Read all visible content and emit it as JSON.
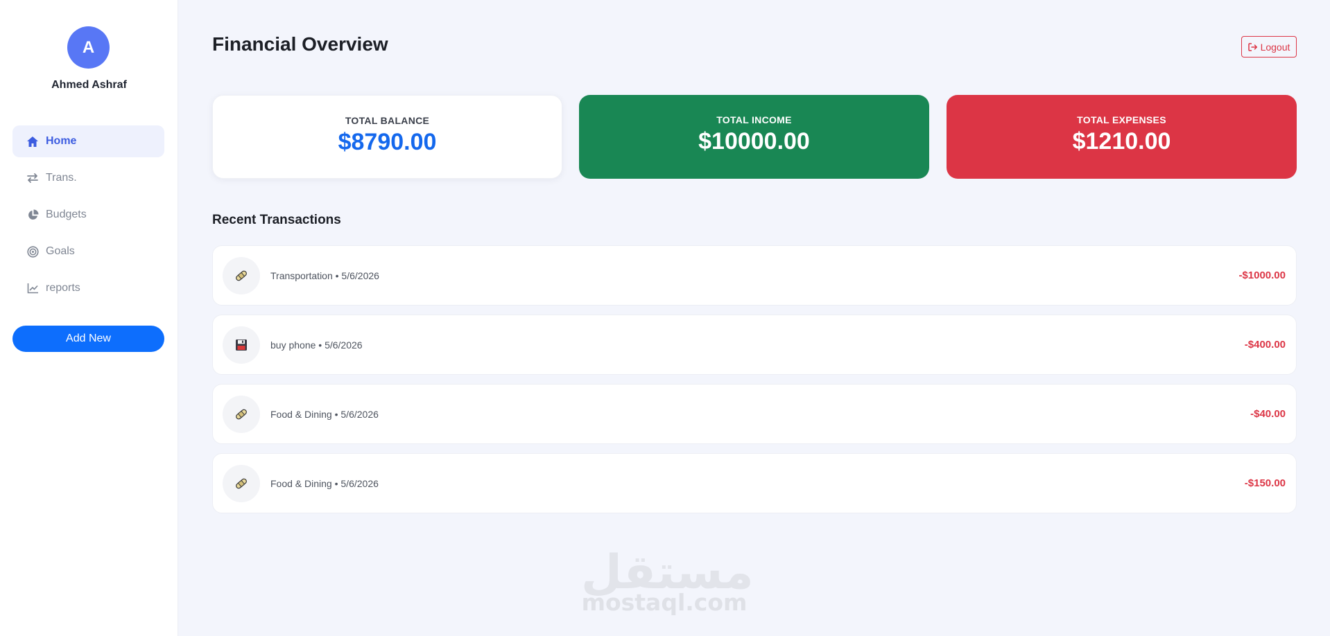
{
  "user": {
    "avatar_letter": "A",
    "name": "Ahmed Ashraf"
  },
  "sidebar": {
    "items": [
      {
        "label": "Home",
        "icon": "home-icon",
        "active": true
      },
      {
        "label": "Trans.",
        "icon": "transfer-arrows-icon",
        "active": false
      },
      {
        "label": "Budgets",
        "icon": "pie-chart-icon",
        "active": false
      },
      {
        "label": "Goals",
        "icon": "target-icon",
        "active": false
      },
      {
        "label": "reports",
        "icon": "line-chart-icon",
        "active": false
      }
    ],
    "add_button_label": "Add New"
  },
  "header": {
    "title": "Financial Overview",
    "logout_label": "Logout"
  },
  "summary": {
    "balance": {
      "label": "TOTAL BALANCE",
      "value": "$8790.00"
    },
    "income": {
      "label": "TOTAL INCOME",
      "value": "$10000.00"
    },
    "expenses": {
      "label": "TOTAL EXPENSES",
      "value": "$1210.00"
    }
  },
  "transactions": {
    "title": "Recent Transactions",
    "items": [
      {
        "icon": "bandage-emoji-icon",
        "description": "Transportation • 5/6/2026",
        "amount": "-$1000.00"
      },
      {
        "icon": "floppy-disk-emoji-icon",
        "description": "buy phone • 5/6/2026",
        "amount": "-$400.00"
      },
      {
        "icon": "bandage-emoji-icon",
        "description": "Food & Dining • 5/6/2026",
        "amount": "-$40.00"
      },
      {
        "icon": "bandage-emoji-icon",
        "description": "Food & Dining • 5/6/2026",
        "amount": "-$150.00"
      }
    ]
  },
  "watermark": {
    "arabic": "مستقل",
    "latin": "mostaql.com"
  },
  "colors": {
    "primary": "#0d6efd",
    "avatar": "#5877f5",
    "active_nav": "#3c5ce0",
    "balance_value": "#1468ed",
    "income_card": "#198754",
    "expenses_card": "#dc3545",
    "negative_amount": "#dc3545",
    "background": "#f3f5fc"
  }
}
